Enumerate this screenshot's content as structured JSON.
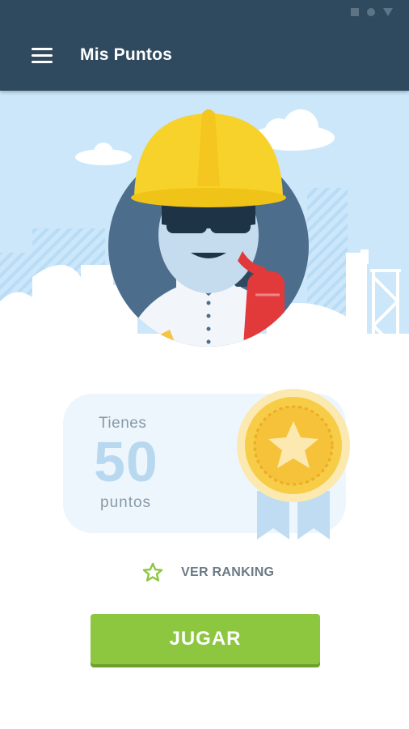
{
  "app_bar": {
    "title": "Mis Puntos"
  },
  "points_card": {
    "prefix": "Tienes",
    "value": "50",
    "suffix": "puntos"
  },
  "ranking_link": {
    "label": "VER RANKING"
  },
  "play_button": {
    "label": "JUGAR"
  },
  "colors": {
    "app_bar": "#2f4a5f",
    "sky": "#cce6fa",
    "accent_green": "#8dc63f",
    "medal_gold": "#f5c542",
    "helmet_yellow": "#f7d22a"
  }
}
